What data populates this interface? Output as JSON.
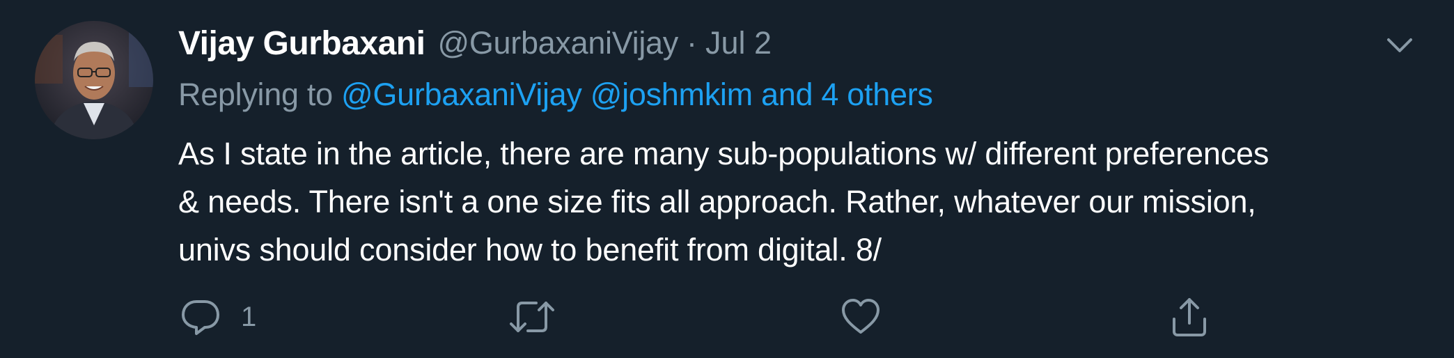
{
  "tweet": {
    "author_name": "Vijay Gurbaxani",
    "handle": "@GurbaxaniVijay",
    "separator": "·",
    "date": "Jul 2",
    "replying_prefix": "Replying to",
    "reply_targets": [
      "@GurbaxaniVijay",
      "@joshmkim",
      "and 4 others"
    ],
    "body_lines": [
      "As I state in the article, there are many sub-populations w/ different preferences",
      "& needs. There isn't a one size fits all approach. Rather, whatever our mission,",
      "univs should consider how to benefit from digital. 8/"
    ]
  },
  "actions": {
    "reply_icon": "reply-icon",
    "reply_count": "1",
    "retweet_icon": "retweet-icon",
    "like_icon": "heart-icon",
    "share_icon": "share-icon"
  },
  "colors": {
    "background": "#15202b",
    "text": "#ffffff",
    "muted": "#8899a6",
    "link": "#1da1f2"
  }
}
